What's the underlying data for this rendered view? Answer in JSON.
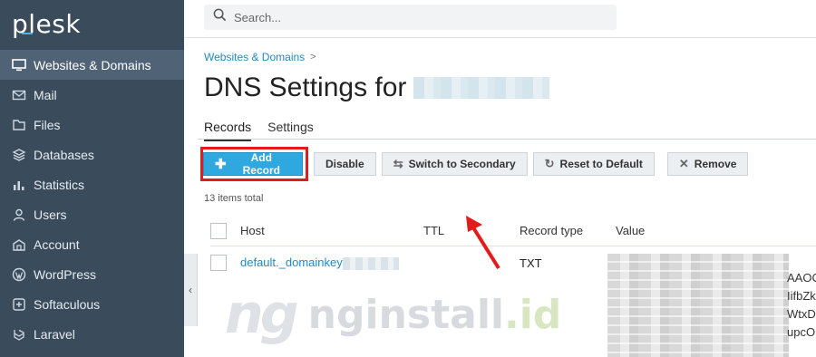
{
  "app": {
    "logo": "plesk"
  },
  "search": {
    "placeholder": "Search..."
  },
  "sidebar": {
    "items": [
      {
        "label": "Websites & Domains",
        "icon": "monitor-icon",
        "active": true
      },
      {
        "label": "Mail",
        "icon": "mail-icon"
      },
      {
        "label": "Files",
        "icon": "folder-icon"
      },
      {
        "label": "Databases",
        "icon": "database-icon"
      },
      {
        "label": "Statistics",
        "icon": "bar-chart-icon"
      },
      {
        "label": "Users",
        "icon": "user-icon"
      },
      {
        "label": "Account",
        "icon": "account-icon"
      },
      {
        "label": "WordPress",
        "icon": "wordpress-icon"
      },
      {
        "label": "Softaculous",
        "icon": "softaculous-icon"
      },
      {
        "label": "Laravel",
        "icon": "laravel-icon"
      }
    ]
  },
  "breadcrumb": {
    "item": "Websites & Domains",
    "separator": ">"
  },
  "page": {
    "title": "DNS Settings for"
  },
  "tabs": [
    {
      "label": "Records",
      "active": true
    },
    {
      "label": "Settings"
    }
  ],
  "toolbar": {
    "add": "Add Record",
    "disable": "Disable",
    "switch": "Switch to Secondary",
    "reset": "Reset to Default",
    "remove": "Remove"
  },
  "count": "13 items total",
  "table": {
    "headers": {
      "host": "Host",
      "ttl": "TTL",
      "type": "Record type",
      "value": "Value"
    },
    "rows": [
      {
        "host": "default._domainkey",
        "ttl": "",
        "type": "TXT"
      }
    ],
    "value_fragments": [
      "AAOC",
      "IifbZk",
      "WtxD",
      "upcO"
    ]
  },
  "watermark": {
    "logo": "ng",
    "text": "nginstall",
    "tld": ".id"
  },
  "colors": {
    "sidebar": "#3a4b5c",
    "primary": "#2fa7df",
    "link": "#1f8ac4",
    "highlight": "#e21b1b"
  }
}
